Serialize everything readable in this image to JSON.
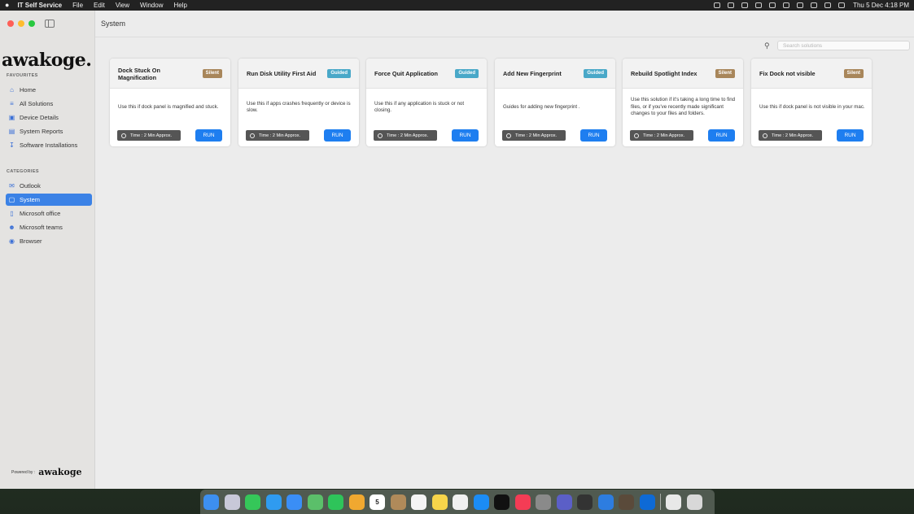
{
  "menubar": {
    "apple": "",
    "app_name": "IT Self Service",
    "menus": [
      "File",
      "Edit",
      "View",
      "Window",
      "Help"
    ],
    "clock": "Thu 5 Dec  4:18 PM"
  },
  "sidebar": {
    "logo_text": "awakoge.",
    "favourites_title": "FAVOURITES",
    "favourites": [
      {
        "label": "Home",
        "icon": "home-icon"
      },
      {
        "label": "All Solutions",
        "icon": "list-icon"
      },
      {
        "label": "Device Details",
        "icon": "device-icon"
      },
      {
        "label": "System Reports",
        "icon": "report-icon"
      },
      {
        "label": "Software Installations",
        "icon": "download-icon"
      }
    ],
    "categories_title": "CATEGORIES",
    "categories": [
      {
        "label": "Outlook",
        "icon": "mail-icon"
      },
      {
        "label": "System",
        "icon": "monitor-icon",
        "active": true
      },
      {
        "label": "Microsoft office",
        "icon": "document-icon"
      },
      {
        "label": "Microsoft teams",
        "icon": "people-icon"
      },
      {
        "label": "Browser",
        "icon": "globe-icon"
      }
    ],
    "powered_by": "Powered by :",
    "powered_logo": "awakoge"
  },
  "main": {
    "title": "System",
    "search_placeholder": "Search solutions"
  },
  "cards": [
    {
      "title": "Dock Stuck On Magnification",
      "badge": "Silent",
      "badge_type": "silent",
      "description": "Use this if dock panel is magnified and stuck.",
      "time": "Time : 2 Min Approx.",
      "run": "RUN"
    },
    {
      "title": "Run Disk Utility First Aid",
      "badge": "Guided",
      "badge_type": "guided",
      "description": "Use this if apps crashes frequently or device is slow.",
      "time": "Time : 2 Min Approx.",
      "run": "RUN"
    },
    {
      "title": "Force Quit Application",
      "badge": "Guided",
      "badge_type": "guided",
      "description": "Use this if any application is stuck or not closing.",
      "time": "Time : 2 Min Approx.",
      "run": "RUN"
    },
    {
      "title": "Add New Fingerprint",
      "badge": "Guided",
      "badge_type": "guided",
      "description": "Guides for adding new fingerprint .",
      "time": "Time : 2 Min Approx.",
      "run": "RUN"
    },
    {
      "title": "Rebuild Spotlight Index",
      "badge": "Silent",
      "badge_type": "silent",
      "description": "Use this solution if it's taking a long time to find files, or if you've recently made significant changes to your files and folders.",
      "time": "Time : 2 Min Approx.",
      "run": "RUN"
    },
    {
      "title": "Fix Dock not visible",
      "badge": "Silent",
      "badge_type": "silent",
      "description": "Use this if dock panel is not visible in your mac.",
      "time": "Time : 2 Min Approx.",
      "run": "RUN"
    }
  ],
  "dock": {
    "calendar_day": "5",
    "apps": [
      {
        "name": "finder-icon",
        "color": "#3d8ff0"
      },
      {
        "name": "launchpad-icon",
        "color": "#c8c8d8"
      },
      {
        "name": "messages-icon",
        "color": "#35c759"
      },
      {
        "name": "safari-icon",
        "color": "#2f9bf0"
      },
      {
        "name": "mail-icon",
        "color": "#3a8ef6"
      },
      {
        "name": "maps-icon",
        "color": "#5bbf6a"
      },
      {
        "name": "facetime-icon",
        "color": "#2ec45a"
      },
      {
        "name": "photos-icon",
        "color": "#f0a830"
      },
      {
        "name": "calendar-icon",
        "color": "#ffffff"
      },
      {
        "name": "contacts-icon",
        "color": "#b08a5a"
      },
      {
        "name": "reminders-icon",
        "color": "#f4f4f4"
      },
      {
        "name": "notes-icon",
        "color": "#f7d44a"
      },
      {
        "name": "freeform-icon",
        "color": "#f0f0f0"
      },
      {
        "name": "app-store-icon",
        "color": "#1b8cf5"
      },
      {
        "name": "tv-icon",
        "color": "#111111"
      },
      {
        "name": "music-icon",
        "color": "#f43c55"
      },
      {
        "name": "system-settings-icon",
        "color": "#8a8a8a"
      },
      {
        "name": "teams-icon",
        "color": "#5b5fc7"
      },
      {
        "name": "activity-monitor-icon",
        "color": "#333333"
      },
      {
        "name": "xcode-icon",
        "color": "#2d7de0"
      },
      {
        "name": "it-self-service-icon",
        "color": "#5a4a3a"
      },
      {
        "name": "teamviewer-icon",
        "color": "#0e6ad6"
      },
      {
        "name": "document-icon",
        "color": "#e8e8e8"
      },
      {
        "name": "trash-icon",
        "color": "#d8d8d8"
      }
    ]
  }
}
